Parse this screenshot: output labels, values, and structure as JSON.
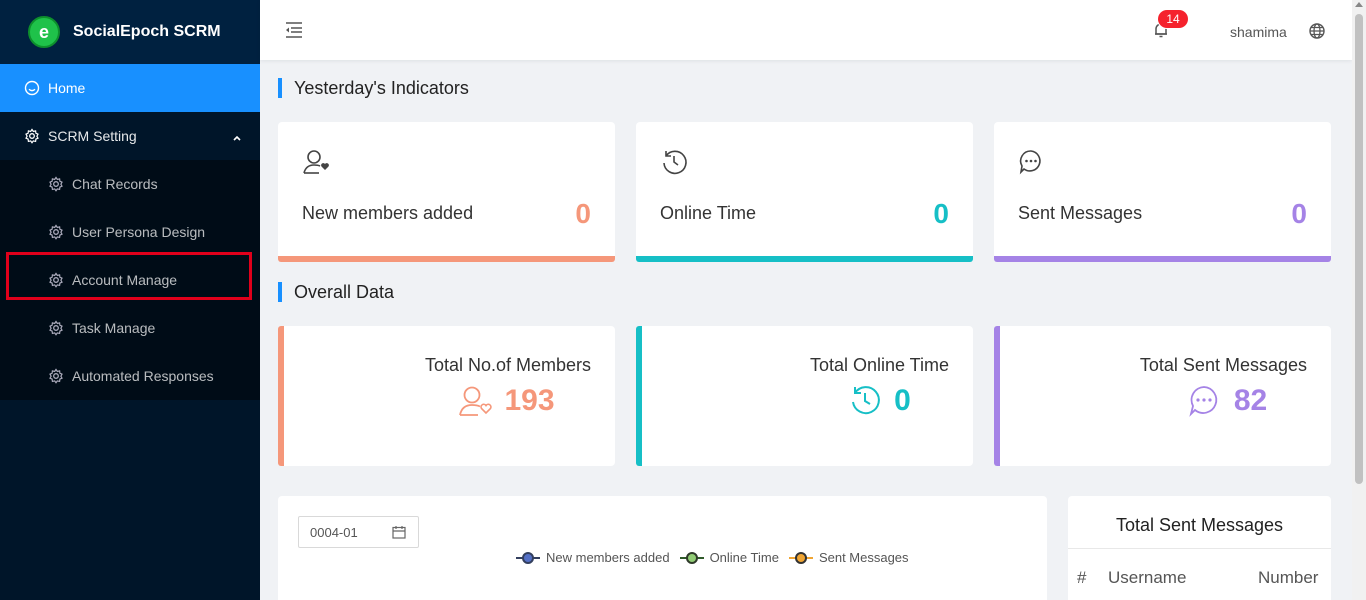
{
  "app": {
    "title": "SocialEpoch SCRM",
    "logo_letter": "e"
  },
  "sidebar": {
    "items": [
      {
        "label": "Home",
        "icon": "smile-icon"
      },
      {
        "label": "SCRM Setting",
        "icon": "gear-icon",
        "expanded": true
      }
    ],
    "submenu": [
      {
        "label": "Chat Records"
      },
      {
        "label": "User Persona Design"
      },
      {
        "label": "Account Manage"
      },
      {
        "label": "Task Manage"
      },
      {
        "label": "Automated Responses"
      }
    ]
  },
  "header": {
    "notification_count": "14",
    "username": "shamima"
  },
  "sections": {
    "yesterday": "Yesterday's Indicators",
    "overall": "Overall Data"
  },
  "indicators": [
    {
      "label": "New members added",
      "value": "0",
      "color": "#f5977a",
      "icon": "user-heart-icon"
    },
    {
      "label": "Online Time",
      "value": "0",
      "color": "#16bfc6",
      "icon": "clock-history-icon"
    },
    {
      "label": "Sent Messages",
      "value": "0",
      "color": "#a583e6",
      "icon": "chat-bubble-icon"
    }
  ],
  "overall": [
    {
      "label": "Total No.of Members",
      "value": "193",
      "color": "#f5977a",
      "icon": "user-heart-icon"
    },
    {
      "label": "Total Online Time",
      "value": "0",
      "color": "#16bfc6",
      "icon": "clock-history-icon"
    },
    {
      "label": "Total Sent Messages",
      "value": "82",
      "color": "#a583e6",
      "icon": "chat-bubble-icon"
    }
  ],
  "chart": {
    "date_value": "0004-01",
    "legend": [
      {
        "label": "New members added",
        "color": "#333f5e"
      },
      {
        "label": "Online Time",
        "color": "#2f5a2a"
      },
      {
        "label": "Sent Messages",
        "color": "#f0a533"
      }
    ]
  },
  "sent_table": {
    "title": "Total Sent Messages",
    "columns": [
      "#",
      "Username",
      "Number"
    ]
  }
}
